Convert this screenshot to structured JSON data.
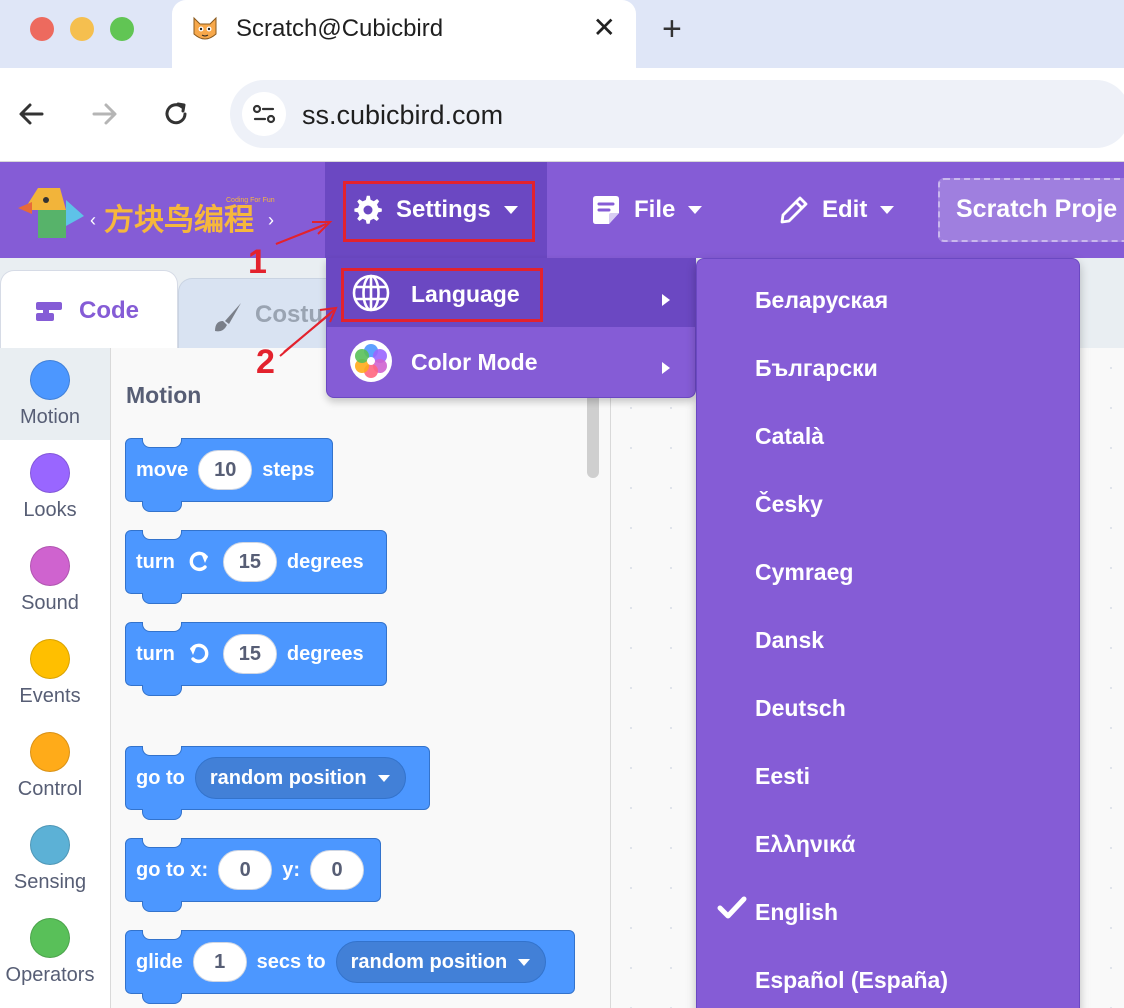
{
  "browser": {
    "tab_title": "Scratch@Cubicbird",
    "url": "ss.cubicbird.com"
  },
  "menubar": {
    "logo_text": "方块鸟编程",
    "logo_tagline": "Coding For Fun",
    "settings_label": "Settings",
    "file_label": "File",
    "edit_label": "Edit",
    "project_title": "Scratch Proje"
  },
  "settings_menu": {
    "items": [
      {
        "label": "Language",
        "icon": "globe-icon"
      },
      {
        "label": "Color Mode",
        "icon": "color-wheel-icon"
      }
    ]
  },
  "annotations": {
    "step1": "1",
    "step2": "2",
    "highlight_color": "#e3222d"
  },
  "editor_tabs": {
    "code": "Code",
    "costumes": "Costu"
  },
  "categories": [
    {
      "name": "Motion",
      "color": "#4c97ff"
    },
    {
      "name": "Looks",
      "color": "#9966ff"
    },
    {
      "name": "Sound",
      "color": "#cf63cf"
    },
    {
      "name": "Events",
      "color": "#ffbf00"
    },
    {
      "name": "Control",
      "color": "#ffab19"
    },
    {
      "name": "Sensing",
      "color": "#5cb1d6"
    },
    {
      "name": "Operators",
      "color": "#59c059"
    }
  ],
  "palette": {
    "heading": "Motion",
    "blocks": {
      "move": {
        "t1": "move",
        "v1": "10",
        "t2": "steps"
      },
      "turn_right": {
        "t1": "turn",
        "v1": "15",
        "t2": "degrees"
      },
      "turn_left": {
        "t1": "turn",
        "v1": "15",
        "t2": "degrees"
      },
      "goto": {
        "t1": "go to",
        "d1": "random position"
      },
      "goto_xy": {
        "t1": "go to x:",
        "v1": "0",
        "t2": "y:",
        "v2": "0"
      },
      "glide": {
        "t1": "glide",
        "v1": "1",
        "t2": "secs to",
        "d1": "random position"
      }
    }
  },
  "languages": [
    {
      "name": "Беларуская",
      "selected": false
    },
    {
      "name": "Български",
      "selected": false
    },
    {
      "name": "Català",
      "selected": false
    },
    {
      "name": "Česky",
      "selected": false
    },
    {
      "name": "Cymraeg",
      "selected": false
    },
    {
      "name": "Dansk",
      "selected": false
    },
    {
      "name": "Deutsch",
      "selected": false
    },
    {
      "name": "Eesti",
      "selected": false
    },
    {
      "name": "Ελληνικά",
      "selected": false
    },
    {
      "name": "English",
      "selected": true
    },
    {
      "name": "Español (España)",
      "selected": false
    }
  ],
  "colors": {
    "menu_purple": "#855cd6",
    "menu_purple_dark": "#6b48c2",
    "motion_blue": "#4c97ff"
  }
}
